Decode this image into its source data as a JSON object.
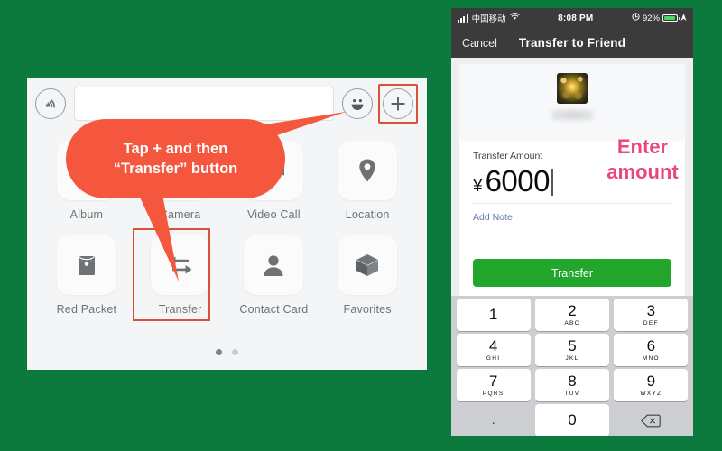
{
  "colors": {
    "background_green": "#0b7a3c",
    "callout_red": "#f4573e",
    "highlight_red": "#d9513c",
    "pink_annotation": "#e8477f",
    "transfer_green": "#22a62b",
    "battery_green": "#4cd964"
  },
  "left_panel": {
    "input_bar": {
      "voice_icon": "voice-waves-icon",
      "text_field_value": "",
      "text_field_placeholder": "",
      "emoji_icon": "smiley-face-icon",
      "plus_icon": "plus-icon"
    },
    "apps": [
      {
        "label": "Album",
        "icon": "photo-album-icon"
      },
      {
        "label": "Camera",
        "icon": "camera-icon"
      },
      {
        "label": "Video Call",
        "icon": "video-camera-icon"
      },
      {
        "label": "Location",
        "icon": "map-pin-icon"
      },
      {
        "label": "Red Packet",
        "icon": "red-envelope-icon"
      },
      {
        "label": "Transfer",
        "icon": "transfer-arrows-icon"
      },
      {
        "label": "Contact Card",
        "icon": "person-icon"
      },
      {
        "label": "Favorites",
        "icon": "cube-box-icon"
      }
    ],
    "pagination": {
      "total": 2,
      "active_index": 0
    },
    "callout": {
      "line1": "Tap + and then",
      "line2": "“Transfer” button"
    }
  },
  "phone": {
    "status_bar": {
      "carrier": "中国移动",
      "wifi_icon": "wifi-icon",
      "signal_icon": "signal-bars-icon",
      "time": "8:08 PM",
      "alarm_icon": "alarm-clock-icon",
      "battery_percent": "92%",
      "battery_icon": "battery-icon",
      "location_icon": "location-arrow-icon"
    },
    "nav_bar": {
      "cancel_label": "Cancel",
      "title": "Transfer to Friend"
    },
    "transfer_card": {
      "avatar": "contact-avatar",
      "contact_name_redacted": "",
      "amount_label": "Transfer Amount",
      "currency_symbol": "¥",
      "amount_value": "6000",
      "add_note_label": "Add Note",
      "transfer_button_label": "Transfer"
    },
    "annotation": {
      "line1": "Enter",
      "line2": "amount"
    },
    "keypad": {
      "rows": [
        [
          {
            "num": "1",
            "sub": ""
          },
          {
            "num": "2",
            "sub": "ABC"
          },
          {
            "num": "3",
            "sub": "DEF"
          }
        ],
        [
          {
            "num": "4",
            "sub": "GHI"
          },
          {
            "num": "5",
            "sub": "JKL"
          },
          {
            "num": "6",
            "sub": "MNO"
          }
        ],
        [
          {
            "num": "7",
            "sub": "PQRS"
          },
          {
            "num": "8",
            "sub": "TUV"
          },
          {
            "num": "9",
            "sub": "WXYZ"
          }
        ]
      ],
      "dot_key": ".",
      "zero_key": "0",
      "delete_icon": "backspace-delete-icon"
    }
  }
}
